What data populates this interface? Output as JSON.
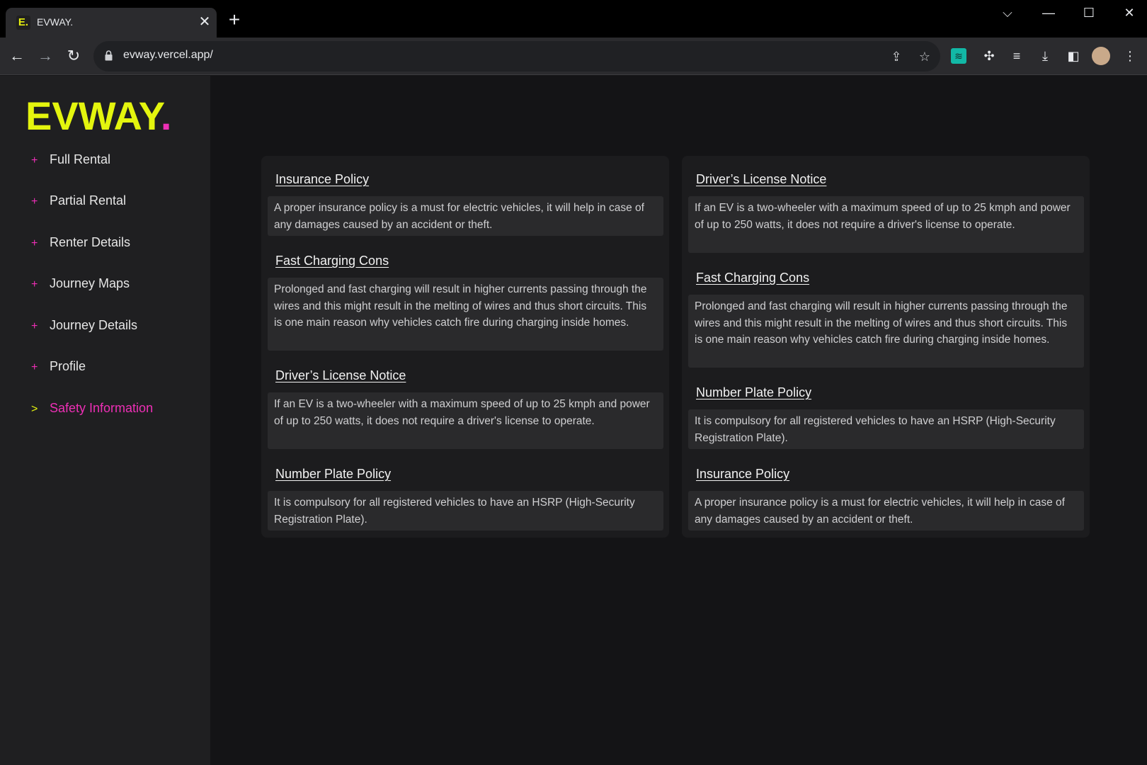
{
  "browser": {
    "tab_title": "EVWAY.",
    "tab_favicon_letter": "E.",
    "url": "evway.vercel.app/"
  },
  "brand": {
    "logo_text": "EVWAY",
    "logo_dot": ".",
    "accent_yellow": "#e4f50e",
    "accent_pink": "#ee2fb6"
  },
  "sidebar": {
    "items": [
      {
        "marker": "+",
        "label": "Full Rental"
      },
      {
        "marker": "+",
        "label": "Partial Rental"
      },
      {
        "marker": "+",
        "label": "Renter Details"
      },
      {
        "marker": "+",
        "label": "Journey Maps"
      },
      {
        "marker": "+",
        "label": "Journey Details"
      },
      {
        "marker": "+",
        "label": "Profile"
      },
      {
        "marker": ">",
        "label": "Safety Information",
        "active": true
      }
    ]
  },
  "cards": [
    {
      "sections": [
        {
          "title": "Insurance Policy",
          "body": "A proper insurance policy is a must for electric vehicles, it will help in case of any damages caused by an accident or theft."
        },
        {
          "title": "Fast Charging Cons",
          "body": "Prolonged and fast charging will result in higher currents passing through the wires and this might result in the melting of wires and thus short circuits. This is one main reason why vehicles catch fire during charging inside homes."
        },
        {
          "title": "Driver’s License Notice",
          "body": "If an EV is a two-wheeler with a maximum speed of up to 25 kmph and power of up to 250 watts, it does not require a driver's license to operate."
        },
        {
          "title": "Number Plate Policy",
          "body": "It is compulsory for all registered vehicles to have an HSRP (High-Security Registration Plate)."
        }
      ]
    },
    {
      "sections": [
        {
          "title": "Driver’s License Notice",
          "body": "If an EV is a two-wheeler with a maximum speed of up to 25 kmph and power of up to 250 watts, it does not require a driver's license to operate."
        },
        {
          "title": "Fast Charging Cons",
          "body": "Prolonged and fast charging will result in higher currents passing through the wires and this might result in the melting of wires and thus short circuits. This is one main reason why vehicles catch fire during charging inside homes."
        },
        {
          "title": "Number Plate Policy",
          "body": "It is compulsory for all registered vehicles to have an HSRP (High-Security Registration Plate)."
        },
        {
          "title": "Insurance Policy",
          "body": "A proper insurance policy is a must for electric vehicles, it will help in case of any damages caused by an accident or theft."
        }
      ]
    }
  ]
}
